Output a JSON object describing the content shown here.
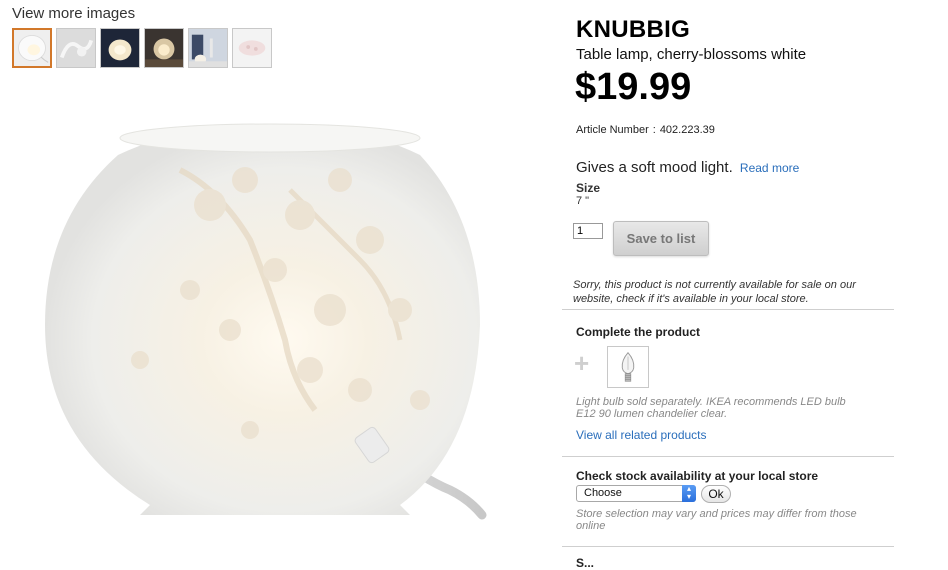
{
  "gallery": {
    "view_more_label": "View more images",
    "thumbnails": [
      "lamp-front-thumbnail",
      "lamp-detail-thumbnail",
      "lamp-lit-thumbnail",
      "lamp-glow-thumbnail",
      "lamp-room-thumbnail",
      "lamp-pattern-thumbnail"
    ]
  },
  "product": {
    "name": "KNUBBIG",
    "description": "Table lamp, cherry-blossoms white",
    "price": "$19.99",
    "article_label": "Article Number",
    "article_sep": ":",
    "article_number": "402.223.39",
    "tagline": "Gives a soft mood light.",
    "read_more": "Read more",
    "size_label": "Size",
    "size_value": "7 \""
  },
  "purchase": {
    "quantity": "1",
    "save_label": "Save to list",
    "notice": "Sorry, this product is not currently available for sale on our website, check if it's available in your local store."
  },
  "complete_product": {
    "title": "Complete the product",
    "plus_icon": "+",
    "bulb_note": "Light bulb sold separately. IKEA recommends LED bulb E12 90 lumen chandelier clear.",
    "related_link": "View all related products"
  },
  "stock": {
    "title": "Check stock availability at your local store",
    "select_value": "Choose",
    "ok_label": "Ok",
    "note": "Store selection may vary and prices may differ from those online"
  },
  "next_section": {
    "title": "S..."
  },
  "colors": {
    "accent_border": "#d2782a",
    "link": "#2a6ebb",
    "text": "#333333",
    "muted": "#888888"
  }
}
